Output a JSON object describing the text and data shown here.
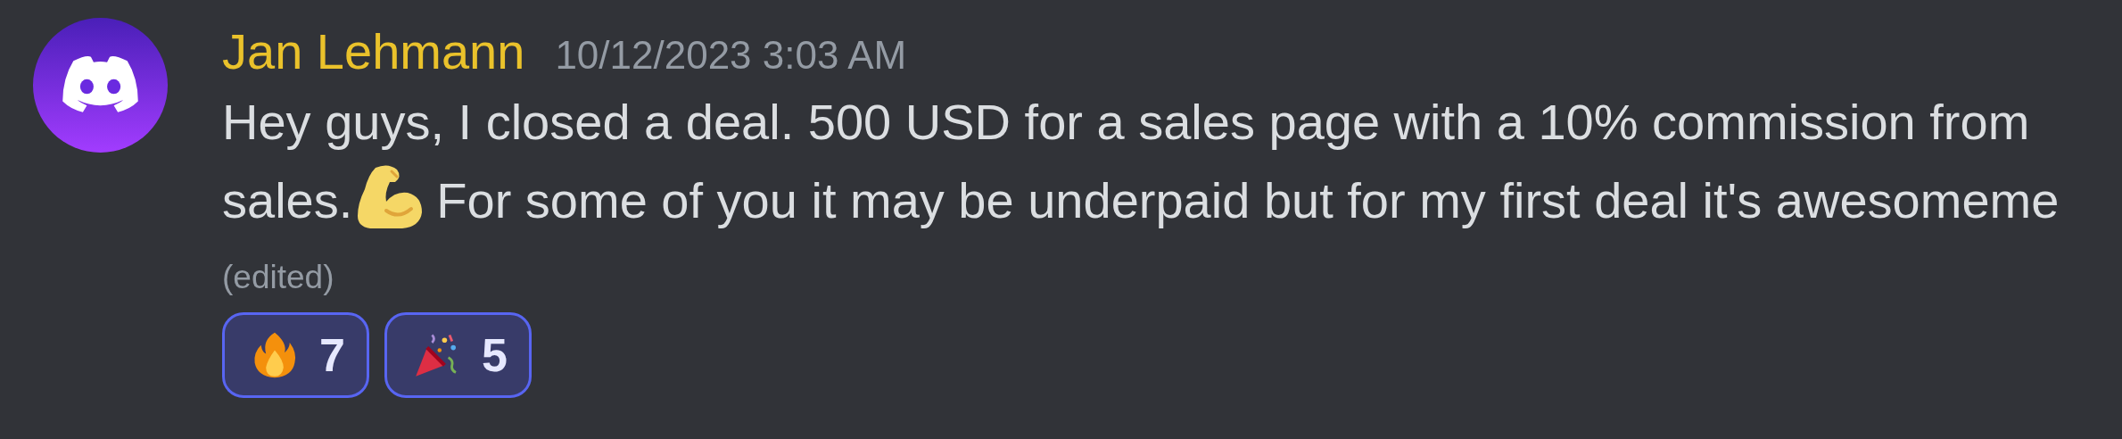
{
  "message": {
    "author": {
      "name": "Jan Lehmann"
    },
    "timestamp": "10/12/2023 3:03 AM",
    "lines": [
      [
        {
          "kind": "text",
          "text": "Hey guys, I closed a deal. 500 USD for a sales page with a 10% commission from"
        }
      ],
      [
        {
          "kind": "text",
          "text": "sales."
        },
        {
          "kind": "emoji"
        },
        {
          "kind": "text",
          "text": "For some of you it may be underpaid but for my first deal it's awesomeme"
        }
      ]
    ],
    "edited_label": "(edited)",
    "reactions": [
      {
        "kind": "fire",
        "count": "7",
        "selected": true
      },
      {
        "kind": "party",
        "count": "5",
        "selected": true
      }
    ]
  }
}
